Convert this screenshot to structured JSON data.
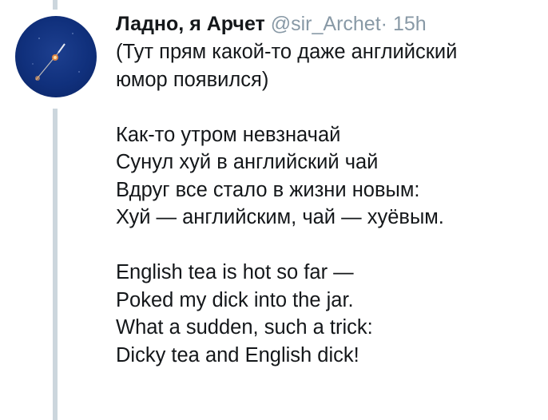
{
  "tweet": {
    "display_name": "Ладно, я Арчет",
    "handle": "@sir_Archet",
    "separator": "·",
    "time": "15h",
    "lines": [
      "(Тут прям какой-то даже английский",
      "юмор появился)",
      "",
      "Как-то утром невзначай",
      "Сунул хуй в английский чай",
      "Вдруг все стало в жизни новым:",
      "Хуй — английским, чай — хуёвым.",
      "",
      "English tea is hot so far —",
      "Poked my dick into the jar.",
      "What a sudden, such a trick:",
      "Dicky tea and English dick!"
    ]
  },
  "avatar": {
    "icon": "rocket-launch-icon",
    "colors": {
      "background": "#10307c",
      "accent": "#f08a3c"
    }
  },
  "colors": {
    "text": "#14171a",
    "muted": "#8899a6",
    "thread_line": "#ccd6dd"
  }
}
